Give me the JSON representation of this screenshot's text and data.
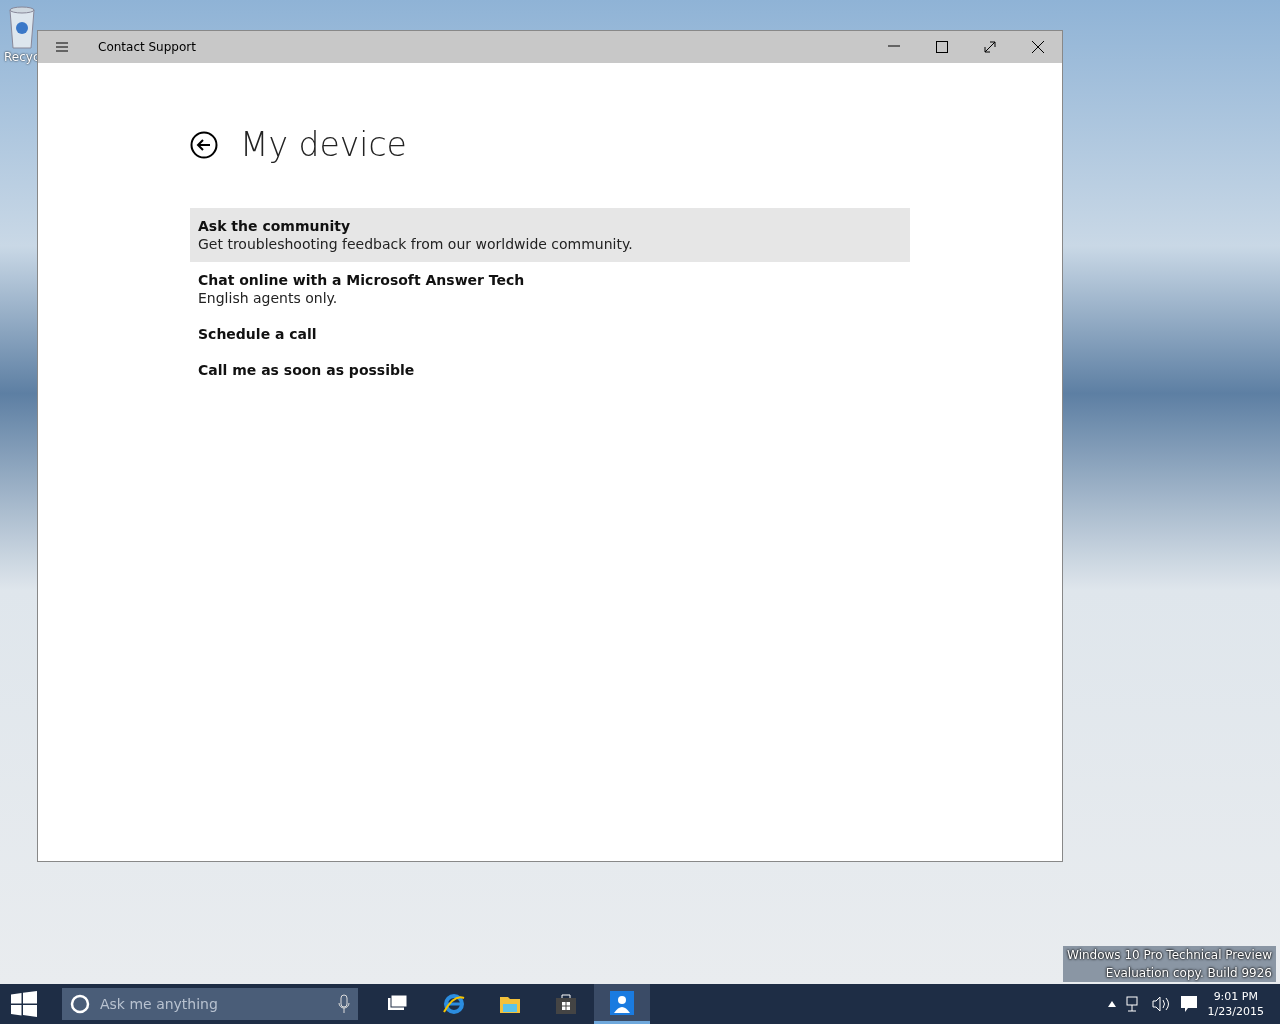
{
  "desktop": {
    "icons": [
      {
        "label": "Recyc"
      }
    ],
    "watermark_lines": [
      "Windows 10 Pro Technical Preview",
      "Evaluation copy. Build 9926"
    ]
  },
  "window": {
    "title": "Contact Support"
  },
  "page": {
    "heading": "My device"
  },
  "options": [
    {
      "title": "Ask the community",
      "subtitle": "Get troubleshooting feedback from our worldwide community.",
      "selected": true
    },
    {
      "title": "Chat online with a Microsoft Answer Tech",
      "subtitle": "English agents only.",
      "selected": false
    },
    {
      "title": "Schedule a call",
      "selected": false
    },
    {
      "title": "Call me as soon as possible",
      "selected": false
    }
  ],
  "taskbar": {
    "search": {
      "placeholder": "Ask me anything"
    },
    "apps": [
      {
        "kind": "taskview",
        "selected": false
      },
      {
        "kind": "browser",
        "selected": false
      },
      {
        "kind": "explorer",
        "selected": false
      },
      {
        "kind": "store",
        "selected": false
      },
      {
        "kind": "support",
        "selected": true
      }
    ],
    "clock": {
      "time": "9:01 PM",
      "date": "1/23/2015"
    }
  }
}
